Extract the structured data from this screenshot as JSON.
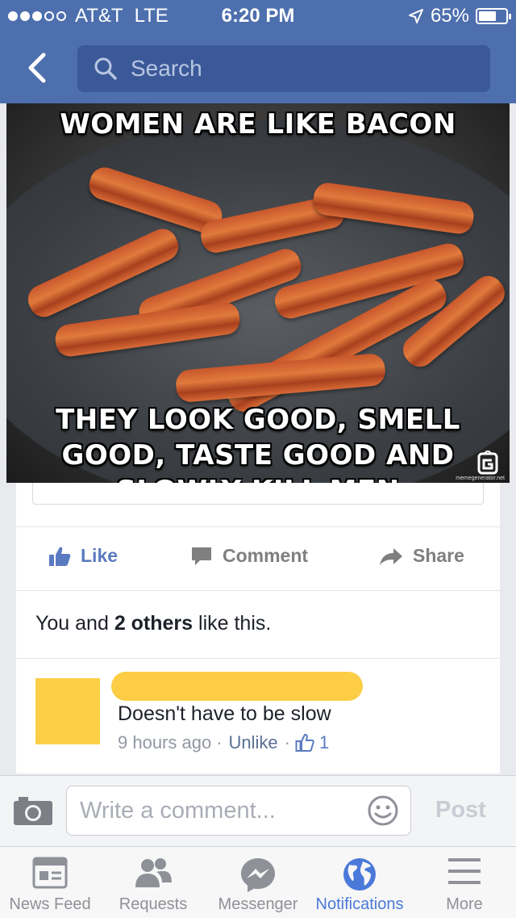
{
  "status_bar": {
    "carrier": "AT&T",
    "network": "LTE",
    "time": "6:20 PM",
    "battery": "65%",
    "battery_level": 0.65
  },
  "nav": {
    "search_placeholder": "Search"
  },
  "post": {
    "meme_top": "WOMEN ARE LIKE BACON",
    "meme_bottom": "THEY LOOK GOOD, SMELL GOOD, TASTE GOOD AND SLOWLY KILL MEN",
    "watermark": "memegenerator.net",
    "actions": {
      "like": "Like",
      "comment": "Comment",
      "share": "Share"
    },
    "likes": {
      "you_and": "You and",
      "others": "2 others",
      "suffix": "like this."
    },
    "comment": {
      "text": "Doesn't have to be slow",
      "time": "9 hours ago",
      "sep": "·",
      "unlike": "Unlike",
      "like_count": "1"
    }
  },
  "composer": {
    "placeholder": "Write a comment...",
    "post_label": "Post"
  },
  "tabs": [
    {
      "label": "News Feed",
      "icon": "news-feed-icon"
    },
    {
      "label": "Requests",
      "icon": "friends-icon"
    },
    {
      "label": "Messenger",
      "icon": "messenger-icon"
    },
    {
      "label": "Notifications",
      "icon": "globe-icon",
      "active": true
    },
    {
      "label": "More",
      "icon": "menu-icon"
    }
  ],
  "colors": {
    "header": "#4d6fae",
    "accent": "#4a79d9",
    "highlight": "#fccd45"
  }
}
